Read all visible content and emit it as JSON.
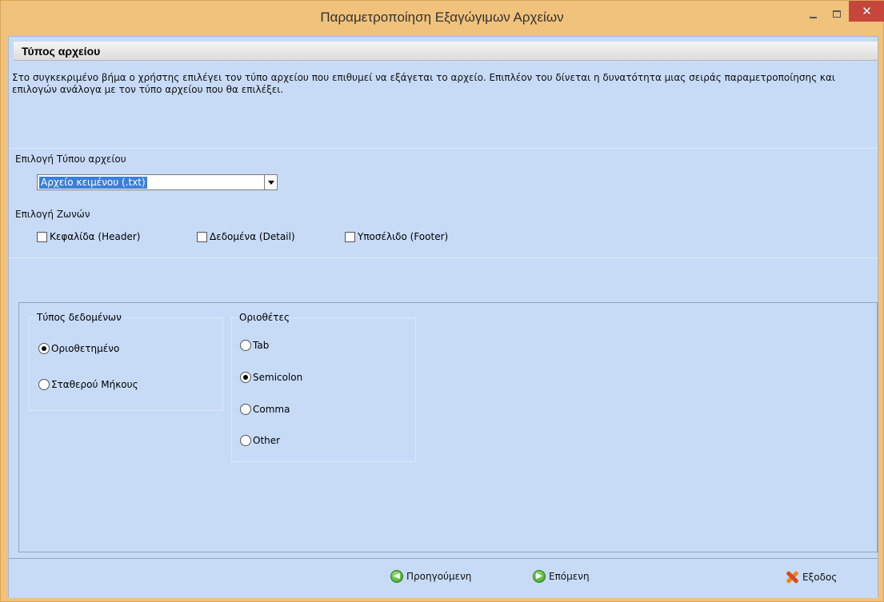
{
  "window": {
    "title": "Παραμετροποίηση Εξαγώγιμων Αρχείων",
    "minimize_glyph": "",
    "close_glyph": "✕"
  },
  "header": {
    "title": "Τύπος αρχείου",
    "description": "Στο συγκεκριμένο βήμα ο χρήστης επιλέγει τον τύπο αρχείου που επιθυμεί να εξάγεται το αρχείο. Επιπλέον του δίνεται η δυνατότητα μιας σειράς παραμετροποίησης και επιλογών ανάλογα με τον τύπο αρχείου που θα επιλέξει."
  },
  "file_type": {
    "label": "Επιλογή Τύπου αρχείου",
    "selected_value": "Αρχείο κειμένου (.txt)"
  },
  "zones": {
    "label": "Επιλογή Ζωνών",
    "items": [
      {
        "label": "Κεφαλίδα (Header)",
        "checked": false
      },
      {
        "label": "Δεδομένα (Detail)",
        "checked": false
      },
      {
        "label": "Υποσέλιδο (Footer)",
        "checked": false
      }
    ]
  },
  "data_type": {
    "title": "Τύπος δεδομένων",
    "options": [
      {
        "label": "Οριοθετημένο",
        "selected": true
      },
      {
        "label": "Σταθερού Μήκους",
        "selected": false
      }
    ]
  },
  "delimiters": {
    "title": "Οριοθέτες",
    "options": [
      {
        "label": "Tab",
        "selected": false
      },
      {
        "label": "Semicolon",
        "selected": true
      },
      {
        "label": "Comma",
        "selected": false
      },
      {
        "label": "Other",
        "selected": false
      }
    ]
  },
  "footer": {
    "previous_label": "Προηγούμενη",
    "next_label": "Επόμενη",
    "exit_label": "Εξοδος"
  },
  "colors": {
    "title_bar": "#f0c27b",
    "client_bg": "#c7dbf6",
    "close_button": "#c7453a",
    "selection": "#3c7fdb"
  }
}
